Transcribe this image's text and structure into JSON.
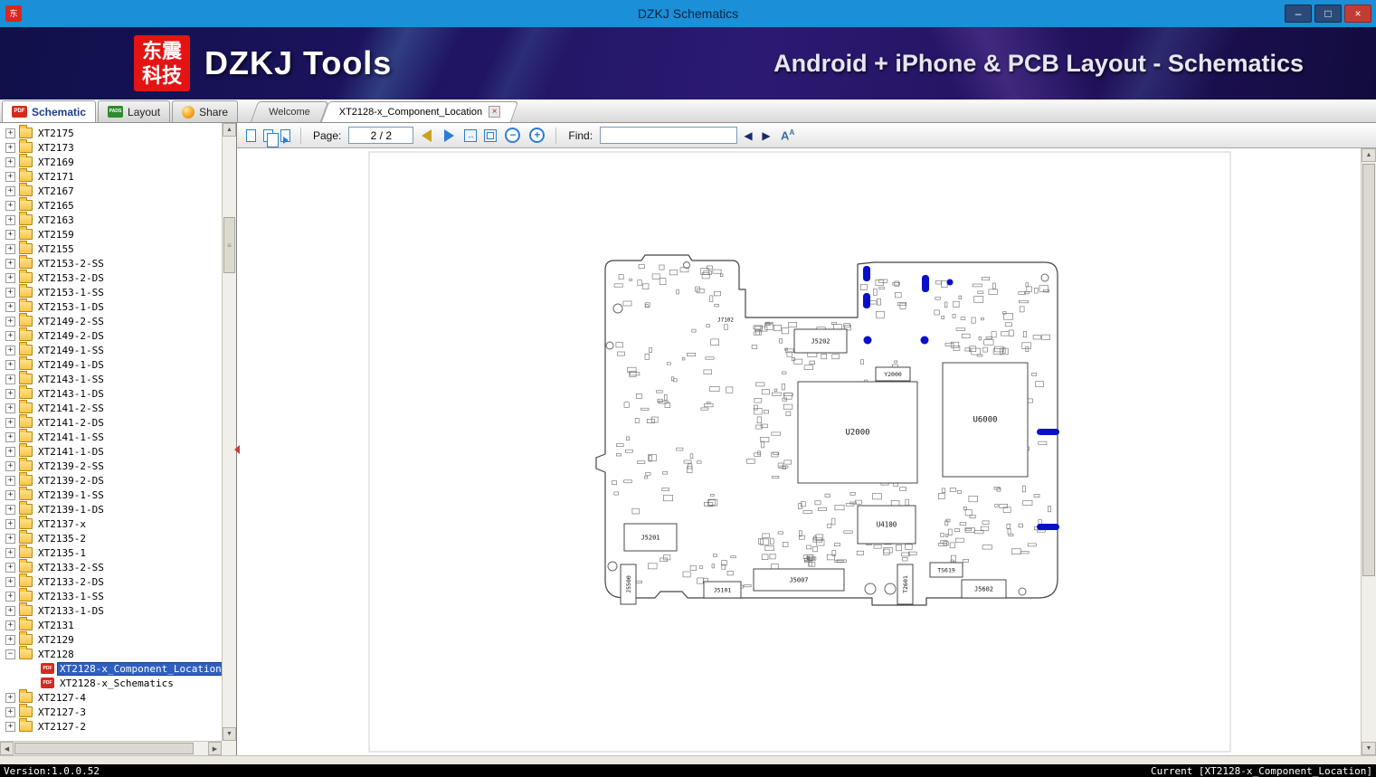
{
  "window": {
    "title": "DZKJ Schematics"
  },
  "banner": {
    "logo_line1": "东震",
    "logo_line2": "科技",
    "app_name": "DZKJ Tools",
    "tagline": "Android + iPhone & PCB Layout - Schematics"
  },
  "tabs": {
    "main": [
      {
        "label": "Schematic",
        "active": true
      },
      {
        "label": "Layout",
        "active": false
      },
      {
        "label": "Share",
        "active": false
      }
    ],
    "documents": [
      {
        "label": "Welcome",
        "active": false
      },
      {
        "label": "XT2128-x_Component_Location",
        "active": true,
        "closable": true
      }
    ]
  },
  "toolbar": {
    "page_label": "Page:",
    "page_value": "2 / 2",
    "find_label": "Find:",
    "find_value": ""
  },
  "sidebar": {
    "items": [
      {
        "label": "XT2175"
      },
      {
        "label": "XT2173"
      },
      {
        "label": "XT2169"
      },
      {
        "label": "XT2171"
      },
      {
        "label": "XT2167"
      },
      {
        "label": "XT2165"
      },
      {
        "label": "XT2163"
      },
      {
        "label": "XT2159"
      },
      {
        "label": "XT2155"
      },
      {
        "label": "XT2153-2-SS"
      },
      {
        "label": "XT2153-2-DS"
      },
      {
        "label": "XT2153-1-SS"
      },
      {
        "label": "XT2153-1-DS"
      },
      {
        "label": "XT2149-2-SS"
      },
      {
        "label": "XT2149-2-DS"
      },
      {
        "label": "XT2149-1-SS"
      },
      {
        "label": "XT2149-1-DS"
      },
      {
        "label": "XT2143-1-SS"
      },
      {
        "label": "XT2143-1-DS"
      },
      {
        "label": "XT2141-2-SS"
      },
      {
        "label": "XT2141-2-DS"
      },
      {
        "label": "XT2141-1-SS"
      },
      {
        "label": "XT2141-1-DS"
      },
      {
        "label": "XT2139-2-SS"
      },
      {
        "label": "XT2139-2-DS"
      },
      {
        "label": "XT2139-1-SS"
      },
      {
        "label": "XT2139-1-DS"
      },
      {
        "label": "XT2137-x"
      },
      {
        "label": "XT2135-2"
      },
      {
        "label": "XT2135-1"
      },
      {
        "label": "XT2133-2-SS"
      },
      {
        "label": "XT2133-2-DS"
      },
      {
        "label": "XT2133-1-SS"
      },
      {
        "label": "XT2133-1-DS"
      },
      {
        "label": "XT2131"
      },
      {
        "label": "XT2129"
      },
      {
        "label": "XT2128",
        "state": "expanded"
      },
      {
        "label": "XT2128-x_Component_Location",
        "level": 1,
        "icon": "pdf",
        "state": "leaf",
        "selected": true
      },
      {
        "label": "XT2128-x_Schematics",
        "level": 1,
        "icon": "pdf",
        "state": "leaf"
      },
      {
        "label": "XT2127-4"
      },
      {
        "label": "XT2127-3"
      },
      {
        "label": "XT2127-2"
      }
    ]
  },
  "viewer": {
    "component_labels": [
      "J7102",
      "J5202",
      "Y2000",
      "U2000",
      "U6000",
      "U4100",
      "J5201",
      "J5500",
      "J5007",
      "J5101",
      "T2601",
      "TS619",
      "J5602"
    ]
  },
  "statusbar": {
    "left": "Version:1.0.0.52",
    "right": "Current [XT2128-x_Component_Location]"
  },
  "icons": {
    "app_logo_char": "东",
    "minimize": "–",
    "maximize": "□",
    "close": "×",
    "pdf_badge": "PDF",
    "pads_badge": "PADS",
    "tab_close": "×",
    "expand": "+",
    "collapse": "−",
    "zoom_out": "−",
    "zoom_in": "+",
    "fit_width": "↔",
    "find_prev": "◀",
    "find_next": "▶",
    "font_size": "A",
    "scroll_up": "▲",
    "scroll_down": "▼",
    "scroll_left": "◀",
    "scroll_right": "▶",
    "grip": "≡"
  },
  "colors": {
    "titlebar": "#1b8fd8",
    "selection": "#2e5fc3",
    "highlight": "#0a10c8",
    "pdf_red": "#d42a1e",
    "pads_green": "#2e8b2e"
  }
}
